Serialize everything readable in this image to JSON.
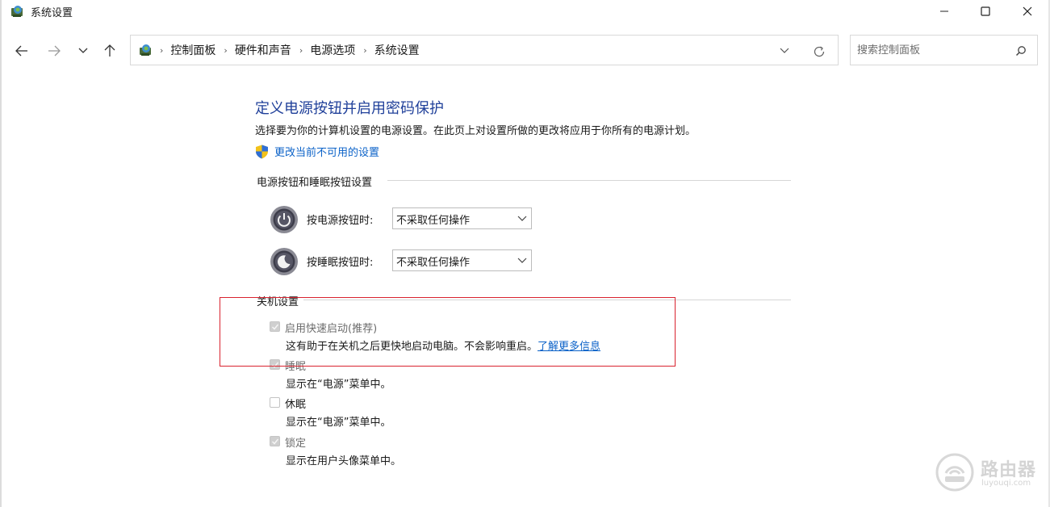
{
  "window": {
    "title": "系统设置"
  },
  "address": {
    "crumbs": [
      "控制面板",
      "硬件和声音",
      "电源选项",
      "系统设置"
    ]
  },
  "search": {
    "placeholder": "搜索控制面板"
  },
  "content": {
    "title": "定义电源按钮并启用密码保护",
    "description": "选择要为你的计算机设置的电源设置。在此页上对设置所做的更改将应用于你所有的电源计划。",
    "change_link": "更改当前不可用的设置"
  },
  "buttons_section": {
    "heading": "电源按钮和睡眠按钮设置",
    "rows": [
      {
        "label": "按电源按钮时:",
        "value": "不采取任何操作",
        "icon": "power-icon"
      },
      {
        "label": "按睡眠按钮时:",
        "value": "不采取任何操作",
        "icon": "sleep-moon-icon"
      }
    ]
  },
  "shutdown_section": {
    "heading": "关机设置",
    "items": [
      {
        "label": "启用快速启动(推荐)",
        "checked": true,
        "desc": "这有助于在关机之后更快地启动电脑。不会影响重启。",
        "link": "了解更多信息"
      },
      {
        "label": "睡眠",
        "checked": true,
        "desc": "显示在“电源”菜单中。"
      },
      {
        "label": "休眠",
        "checked": false,
        "desc": "显示在“电源”菜单中。"
      },
      {
        "label": "锁定",
        "checked": true,
        "desc": "显示在用户头像菜单中。"
      }
    ]
  },
  "watermark": {
    "name": "路由器",
    "site": "luyouqi.com"
  },
  "colors": {
    "link": "#0b62c8",
    "title": "#20409a",
    "highlight": "#d9232f"
  }
}
